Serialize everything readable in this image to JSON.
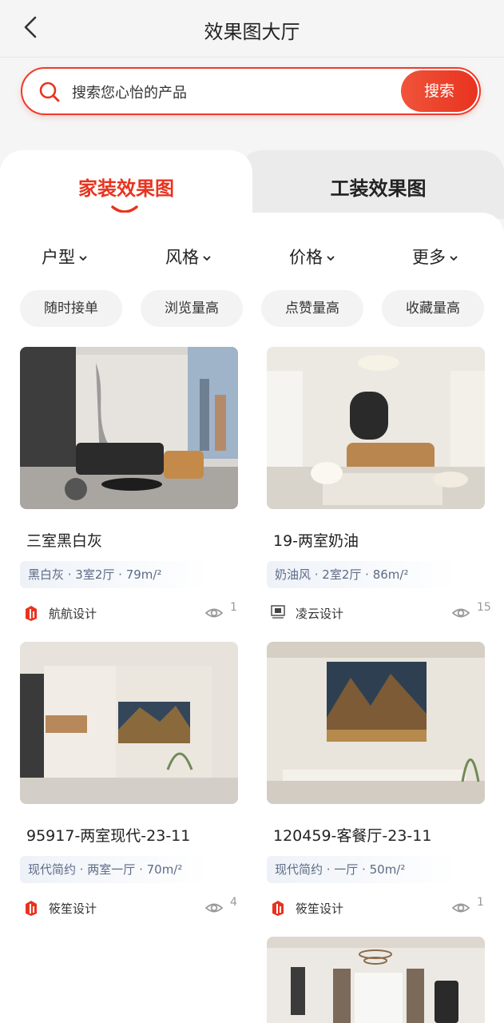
{
  "nav": {
    "title": "效果图大厅"
  },
  "search": {
    "placeholder": "搜索您心怡的产品",
    "button": "搜索"
  },
  "tabs": [
    {
      "label": "家装效果图",
      "active": true
    },
    {
      "label": "工装效果图",
      "active": false
    }
  ],
  "filters": [
    "户型",
    "风格",
    "价格",
    "更多"
  ],
  "chips": [
    "随时接单",
    "浏览量高",
    "点赞量高",
    "收藏量高"
  ],
  "cards": [
    {
      "title": "三室黑白灰",
      "tags": "黑白灰 · 3室2厅 · 79m/²",
      "brand": "航航设计",
      "views": "1"
    },
    {
      "title": "19-两室奶油",
      "tags": "奶油风 · 2室2厅 · 86m/²",
      "brand": "凌云设计",
      "views": "15"
    },
    {
      "title": "95917-两室现代-23-11",
      "tags": "现代简约 · 两室一厅 · 70m/²",
      "brand": "筱笙设计",
      "views": "4"
    },
    {
      "title": "120459-客餐厅-23-11",
      "tags": "现代简约 · 一厅 · 50m/²",
      "brand": "筱笙设计",
      "views": "1"
    }
  ],
  "colors": {
    "accent": "#e8331f",
    "tag_text": "#5d6b86"
  }
}
